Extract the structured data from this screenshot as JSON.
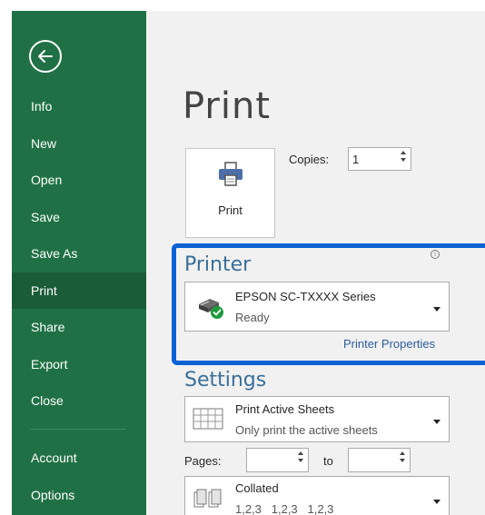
{
  "sidebar": {
    "items": [
      {
        "label": "Info"
      },
      {
        "label": "New"
      },
      {
        "label": "Open"
      },
      {
        "label": "Save"
      },
      {
        "label": "Save As"
      },
      {
        "label": "Print",
        "active": true
      },
      {
        "label": "Share"
      },
      {
        "label": "Export"
      },
      {
        "label": "Close"
      },
      {
        "label": "Account"
      },
      {
        "label": "Options"
      }
    ]
  },
  "main": {
    "title": "Print",
    "print_button_label": "Print",
    "copies": {
      "label": "Copies:",
      "value": "1"
    },
    "printer": {
      "title": "Printer",
      "info_icon": "i",
      "name": "EPSON SC-TXXXX Series",
      "status": "Ready",
      "properties_link": "Printer Properties"
    },
    "settings": {
      "title": "Settings",
      "scope": {
        "title": "Print Active Sheets",
        "subtitle": "Only print the active sheets"
      },
      "pages": {
        "label": "Pages:",
        "from": "",
        "to_label": "to",
        "to": ""
      },
      "collation": {
        "title": "Collated",
        "subtitle": "1,2,3   1,2,3   1,2,3"
      }
    }
  },
  "colors": {
    "sidebar_bg": "#1f7145",
    "sidebar_active": "#195c37",
    "highlight_border": "#0a62d4",
    "section_title": "#3a6f99",
    "link": "#2b5d9c"
  }
}
